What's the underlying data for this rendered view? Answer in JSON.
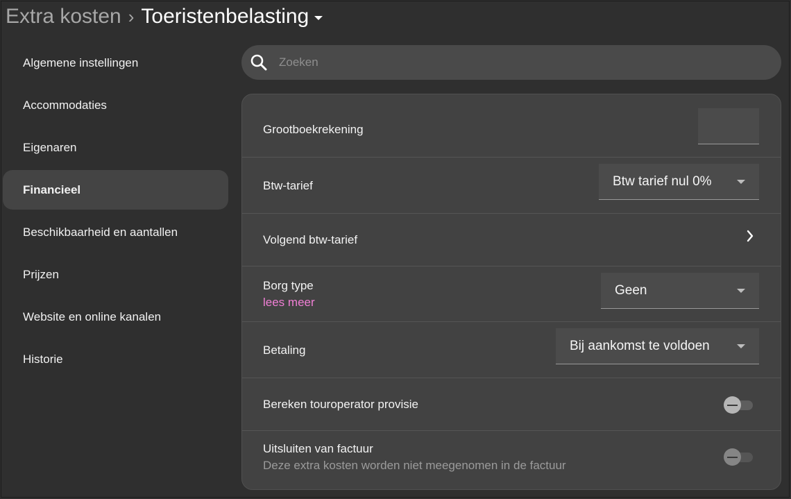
{
  "header": {
    "parent": "Extra kosten",
    "separator": "›",
    "current": "Toeristenbelasting"
  },
  "sidebar": {
    "items": [
      {
        "label": "Algemene instellingen",
        "active": false
      },
      {
        "label": "Accommodaties",
        "active": false
      },
      {
        "label": "Eigenaren",
        "active": false
      },
      {
        "label": "Financieel",
        "active": true
      },
      {
        "label": "Beschikbaarheid en aantallen",
        "active": false
      },
      {
        "label": "Prijzen",
        "active": false
      },
      {
        "label": "Website en online kanalen",
        "active": false
      },
      {
        "label": "Historie",
        "active": false
      }
    ]
  },
  "search": {
    "placeholder": "Zoeken",
    "value": ""
  },
  "settings": {
    "ledger": {
      "label": "Grootboekrekening",
      "value": ""
    },
    "vat": {
      "label": "Btw-tarief",
      "value": "Btw tarief nul 0%"
    },
    "next_vat": {
      "label": "Volgend btw-tarief"
    },
    "deposit": {
      "label": "Borg type",
      "link": "lees meer",
      "value": "Geen"
    },
    "payment": {
      "label": "Betaling",
      "value": "Bij aankomst te voldoen"
    },
    "tour_operator": {
      "label": "Bereken touroperator provisie",
      "enabled": false
    },
    "exclude_invoice": {
      "label": "Uitsluiten van factuur",
      "description": "Deze extra kosten worden niet meegenomen in de factuur",
      "enabled": false
    }
  },
  "colors": {
    "background": "#2f2f2f",
    "card": "#424242",
    "active_item": "#444444",
    "link": "#f07fd5"
  },
  "icons": {
    "search": "search-icon",
    "caret": "caret-down-icon",
    "chevron": "chevron-right-icon"
  }
}
